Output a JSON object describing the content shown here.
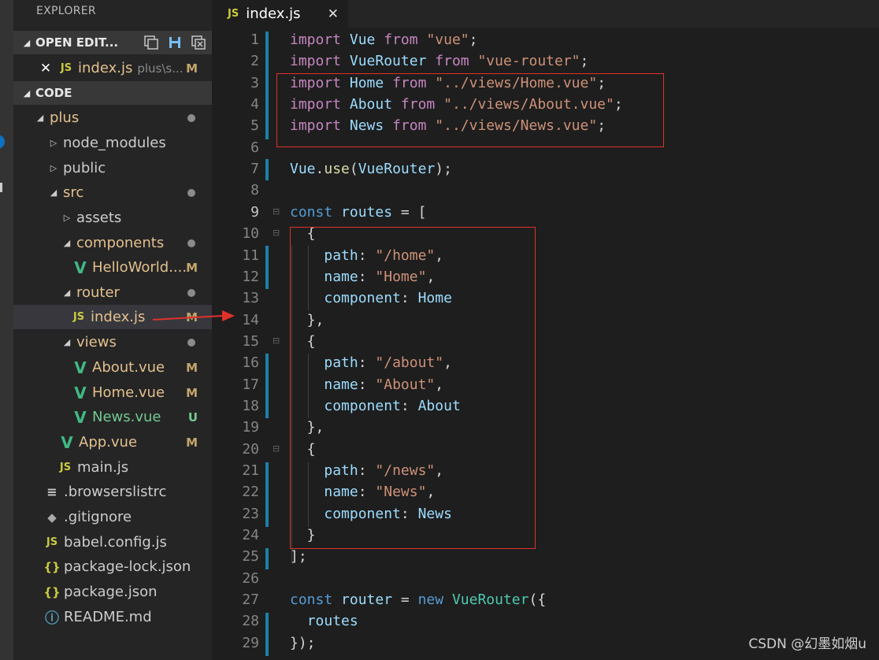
{
  "sidebar": {
    "title": "EXPLORER",
    "open_editors": {
      "label": "OPEN EDIT...",
      "file": "index.js",
      "path": "plus\\s...",
      "badge": "M"
    },
    "code_section": {
      "label": "CODE"
    },
    "tree": [
      {
        "label": "plus",
        "indicator": "dot"
      },
      {
        "label": "node_modules"
      },
      {
        "label": "public"
      },
      {
        "label": "src",
        "indicator": "dot"
      },
      {
        "label": "assets"
      },
      {
        "label": "components",
        "indicator": "dot"
      },
      {
        "label": "HelloWorld....",
        "badge": "M"
      },
      {
        "label": "router",
        "indicator": "dot"
      },
      {
        "label": "index.js",
        "badge": "M"
      },
      {
        "label": "views",
        "indicator": "dot"
      },
      {
        "label": "About.vue",
        "badge": "M"
      },
      {
        "label": "Home.vue",
        "badge": "M"
      },
      {
        "label": "News.vue",
        "badge": "U"
      },
      {
        "label": "App.vue",
        "badge": "M"
      },
      {
        "label": "main.js"
      },
      {
        "label": ".browserslistrc"
      },
      {
        "label": ".gitignore"
      },
      {
        "label": "babel.config.js"
      },
      {
        "label": "package-lock.json"
      },
      {
        "label": "package.json"
      },
      {
        "label": "README.md"
      }
    ],
    "icons": {
      "js": "JS",
      "json": "{}",
      "vue": "V",
      "info": "ⓘ",
      "lines": "≡",
      "git": "◆"
    }
  },
  "tab": {
    "label": "index.js",
    "icon": "JS",
    "close": "✕"
  },
  "editor": {
    "line_numbers": [
      "1",
      "2",
      "3",
      "4",
      "5",
      "6",
      "7",
      "8",
      "9",
      "10",
      "11",
      "12",
      "13",
      "14",
      "15",
      "16",
      "17",
      "18",
      "19",
      "20",
      "21",
      "22",
      "23",
      "24",
      "25",
      "26",
      "27",
      "28",
      "29"
    ],
    "lines": [
      "import Vue from \"vue\";",
      "import VueRouter from \"vue-router\";",
      "import Home from \"../views/Home.vue\";",
      "import About from \"../views/About.vue\";",
      "import News from \"../views/News.vue\";",
      "",
      "Vue.use(VueRouter);",
      "",
      "const routes = [",
      "  {",
      "    path: \"/home\",",
      "    name: \"Home\",",
      "    component: Home",
      "  },",
      "  {",
      "    path: \"/about\",",
      "    name: \"About\",",
      "    component: About",
      "  },",
      "  {",
      "    path: \"/news\",",
      "    name: \"News\",",
      "    component: News",
      "  }",
      "];",
      "",
      "const router = new VueRouter({",
      "  routes",
      "});"
    ]
  },
  "watermark": "CSDN @幻墨如烟u",
  "colors": {
    "annotation": "#e0312b",
    "accent": "#1b81a8"
  }
}
